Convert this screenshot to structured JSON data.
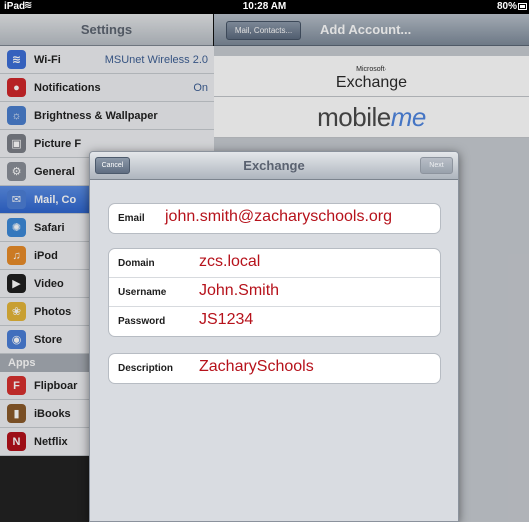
{
  "status_bar": {
    "carrier": "iPad",
    "time": "10:28 AM",
    "battery": "80%"
  },
  "settings": {
    "title": "Settings",
    "items": [
      {
        "label": "Wi-Fi",
        "value": "MSUnet Wireless 2.0",
        "icon": "wifi-icon",
        "color": "#3d6fd8"
      },
      {
        "label": "Notifications",
        "value": "On",
        "icon": "notifications-icon",
        "color": "#d0272b"
      },
      {
        "label": "Brightness & Wallpaper",
        "value": "",
        "icon": "brightness-icon",
        "color": "#4a7fcf"
      },
      {
        "label": "Picture F",
        "value": "",
        "icon": "picture-frame-icon",
        "color": "#7b7f87"
      },
      {
        "label": "General",
        "value": "",
        "icon": "gear-icon",
        "color": "#8a8f98"
      },
      {
        "label": "Mail, Co",
        "value": "",
        "icon": "mail-icon",
        "color": "#4d7fd6"
      },
      {
        "label": "Safari",
        "value": "",
        "icon": "safari-icon",
        "color": "#3d89d8"
      },
      {
        "label": "iPod",
        "value": "",
        "icon": "ipod-icon",
        "color": "#e78b2a"
      },
      {
        "label": "Video",
        "value": "",
        "icon": "video-icon",
        "color": "#1f1f1f"
      },
      {
        "label": "Photos",
        "value": "",
        "icon": "photos-icon",
        "color": "#e4b53a"
      },
      {
        "label": "Store",
        "value": "",
        "icon": "store-icon",
        "color": "#4a7fd8"
      }
    ],
    "apps_header": "Apps",
    "apps": [
      {
        "label": "Flipboar",
        "icon": "flipboard-icon",
        "color": "#d6302e"
      },
      {
        "label": "iBooks",
        "icon": "ibooks-icon",
        "color": "#8a5a2b"
      },
      {
        "label": "Netflix",
        "icon": "netflix-icon",
        "color": "#b3121b"
      }
    ]
  },
  "detail": {
    "back_button": "Mail, Contacts...",
    "title": "Add Account...",
    "providers": [
      {
        "name": "Exchange",
        "brand": "Microsoft·"
      },
      {
        "name": "mobileme"
      }
    ]
  },
  "modal": {
    "title": "Exchange",
    "cancel_label": "Cancel",
    "next_label": "Next",
    "fields": {
      "email_label": "Email",
      "email_value": "john.smith@zacharyschools.org",
      "domain_label": "Domain",
      "domain_value": "zcs.local",
      "username_label": "Username",
      "username_value": "John.Smith",
      "password_label": "Password",
      "password_value": "JS1234",
      "description_label": "Description",
      "description_value": "ZacharySchools"
    }
  }
}
